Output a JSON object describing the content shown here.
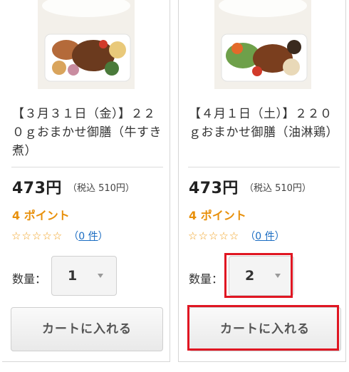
{
  "products": [
    {
      "title": "【３月３１日（金）】２２０ｇおまかせ御膳（牛すき煮）",
      "image_alt": "bento-box-image",
      "price": "473円",
      "tax_price": "（税込 510円）",
      "points": "4 ポイント",
      "stars": "☆☆☆☆☆",
      "review_open": "（",
      "review_count": "0 件",
      "review_close": "）",
      "qty_label": "数量：",
      "qty_value": "1",
      "cart_label": "カートに入れる"
    },
    {
      "title": "【４月１日（土）】２２０ｇおまかせ御膳（油淋鶏）",
      "image_alt": "bento-box-image",
      "price": "473円",
      "tax_price": "（税込 510円）",
      "points": "4 ポイント",
      "stars": "☆☆☆☆☆",
      "review_open": "（",
      "review_count": "0 件",
      "review_close": "）",
      "qty_label": "数量：",
      "qty_value": "2",
      "cart_label": "カートに入れる"
    }
  ],
  "colors": {
    "points": "#e8900b",
    "link": "#1a6cc2",
    "highlight": "#e01622"
  }
}
